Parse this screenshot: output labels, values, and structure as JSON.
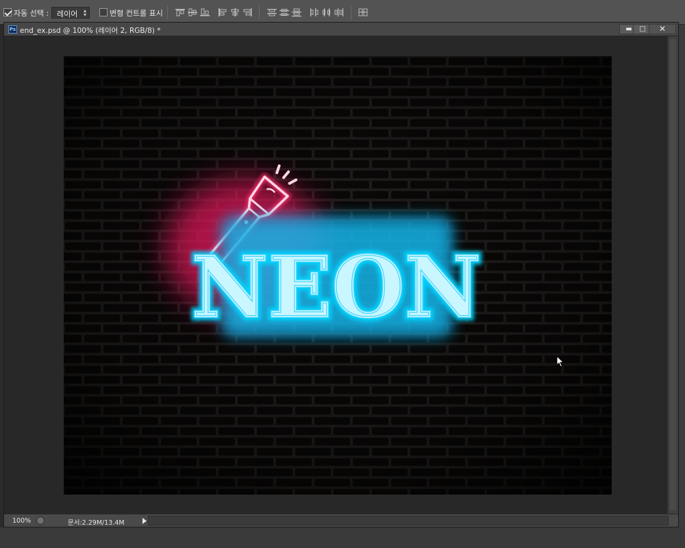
{
  "options_bar": {
    "auto_select_label": "자동 선택 :",
    "auto_select_checked": true,
    "layer_select_value": "레이어",
    "transform_controls_label": "변형 컨트롤 표시",
    "transform_controls_checked": false
  },
  "document": {
    "app_icon_label": "Ps",
    "title": "end_ex.psd @ 100% (레이어 2, RGB/8) *",
    "minimize_symbol": "▬",
    "restore_symbol": "□",
    "close_symbol": "✕",
    "artwork": {
      "sign_text": "NEON",
      "sign_color": "#49d8ff",
      "flashlight_color": "#ff2d6e",
      "wall_color": "#2a2320"
    }
  },
  "status_bar": {
    "zoom": "100%",
    "doc_info": "문서:2.29M/13.4M"
  }
}
